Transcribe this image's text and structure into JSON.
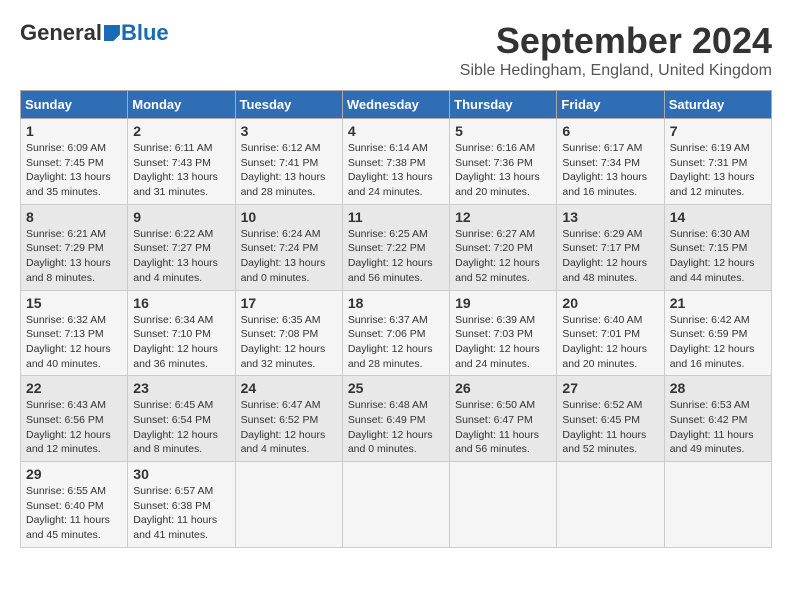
{
  "header": {
    "logo_general": "General",
    "logo_blue": "Blue",
    "month_title": "September 2024",
    "location": "Sible Hedingham, England, United Kingdom"
  },
  "calendar": {
    "days_of_week": [
      "Sunday",
      "Monday",
      "Tuesday",
      "Wednesday",
      "Thursday",
      "Friday",
      "Saturday"
    ],
    "weeks": [
      [
        {
          "day": "1",
          "info": "Sunrise: 6:09 AM\nSunset: 7:45 PM\nDaylight: 13 hours\nand 35 minutes."
        },
        {
          "day": "2",
          "info": "Sunrise: 6:11 AM\nSunset: 7:43 PM\nDaylight: 13 hours\nand 31 minutes."
        },
        {
          "day": "3",
          "info": "Sunrise: 6:12 AM\nSunset: 7:41 PM\nDaylight: 13 hours\nand 28 minutes."
        },
        {
          "day": "4",
          "info": "Sunrise: 6:14 AM\nSunset: 7:38 PM\nDaylight: 13 hours\nand 24 minutes."
        },
        {
          "day": "5",
          "info": "Sunrise: 6:16 AM\nSunset: 7:36 PM\nDaylight: 13 hours\nand 20 minutes."
        },
        {
          "day": "6",
          "info": "Sunrise: 6:17 AM\nSunset: 7:34 PM\nDaylight: 13 hours\nand 16 minutes."
        },
        {
          "day": "7",
          "info": "Sunrise: 6:19 AM\nSunset: 7:31 PM\nDaylight: 13 hours\nand 12 minutes."
        }
      ],
      [
        {
          "day": "8",
          "info": "Sunrise: 6:21 AM\nSunset: 7:29 PM\nDaylight: 13 hours\nand 8 minutes."
        },
        {
          "day": "9",
          "info": "Sunrise: 6:22 AM\nSunset: 7:27 PM\nDaylight: 13 hours\nand 4 minutes."
        },
        {
          "day": "10",
          "info": "Sunrise: 6:24 AM\nSunset: 7:24 PM\nDaylight: 13 hours\nand 0 minutes."
        },
        {
          "day": "11",
          "info": "Sunrise: 6:25 AM\nSunset: 7:22 PM\nDaylight: 12 hours\nand 56 minutes."
        },
        {
          "day": "12",
          "info": "Sunrise: 6:27 AM\nSunset: 7:20 PM\nDaylight: 12 hours\nand 52 minutes."
        },
        {
          "day": "13",
          "info": "Sunrise: 6:29 AM\nSunset: 7:17 PM\nDaylight: 12 hours\nand 48 minutes."
        },
        {
          "day": "14",
          "info": "Sunrise: 6:30 AM\nSunset: 7:15 PM\nDaylight: 12 hours\nand 44 minutes."
        }
      ],
      [
        {
          "day": "15",
          "info": "Sunrise: 6:32 AM\nSunset: 7:13 PM\nDaylight: 12 hours\nand 40 minutes."
        },
        {
          "day": "16",
          "info": "Sunrise: 6:34 AM\nSunset: 7:10 PM\nDaylight: 12 hours\nand 36 minutes."
        },
        {
          "day": "17",
          "info": "Sunrise: 6:35 AM\nSunset: 7:08 PM\nDaylight: 12 hours\nand 32 minutes."
        },
        {
          "day": "18",
          "info": "Sunrise: 6:37 AM\nSunset: 7:06 PM\nDaylight: 12 hours\nand 28 minutes."
        },
        {
          "day": "19",
          "info": "Sunrise: 6:39 AM\nSunset: 7:03 PM\nDaylight: 12 hours\nand 24 minutes."
        },
        {
          "day": "20",
          "info": "Sunrise: 6:40 AM\nSunset: 7:01 PM\nDaylight: 12 hours\nand 20 minutes."
        },
        {
          "day": "21",
          "info": "Sunrise: 6:42 AM\nSunset: 6:59 PM\nDaylight: 12 hours\nand 16 minutes."
        }
      ],
      [
        {
          "day": "22",
          "info": "Sunrise: 6:43 AM\nSunset: 6:56 PM\nDaylight: 12 hours\nand 12 minutes."
        },
        {
          "day": "23",
          "info": "Sunrise: 6:45 AM\nSunset: 6:54 PM\nDaylight: 12 hours\nand 8 minutes."
        },
        {
          "day": "24",
          "info": "Sunrise: 6:47 AM\nSunset: 6:52 PM\nDaylight: 12 hours\nand 4 minutes."
        },
        {
          "day": "25",
          "info": "Sunrise: 6:48 AM\nSunset: 6:49 PM\nDaylight: 12 hours\nand 0 minutes."
        },
        {
          "day": "26",
          "info": "Sunrise: 6:50 AM\nSunset: 6:47 PM\nDaylight: 11 hours\nand 56 minutes."
        },
        {
          "day": "27",
          "info": "Sunrise: 6:52 AM\nSunset: 6:45 PM\nDaylight: 11 hours\nand 52 minutes."
        },
        {
          "day": "28",
          "info": "Sunrise: 6:53 AM\nSunset: 6:42 PM\nDaylight: 11 hours\nand 49 minutes."
        }
      ],
      [
        {
          "day": "29",
          "info": "Sunrise: 6:55 AM\nSunset: 6:40 PM\nDaylight: 11 hours\nand 45 minutes."
        },
        {
          "day": "30",
          "info": "Sunrise: 6:57 AM\nSunset: 6:38 PM\nDaylight: 11 hours\nand 41 minutes."
        },
        {
          "day": "",
          "info": ""
        },
        {
          "day": "",
          "info": ""
        },
        {
          "day": "",
          "info": ""
        },
        {
          "day": "",
          "info": ""
        },
        {
          "day": "",
          "info": ""
        }
      ]
    ]
  }
}
